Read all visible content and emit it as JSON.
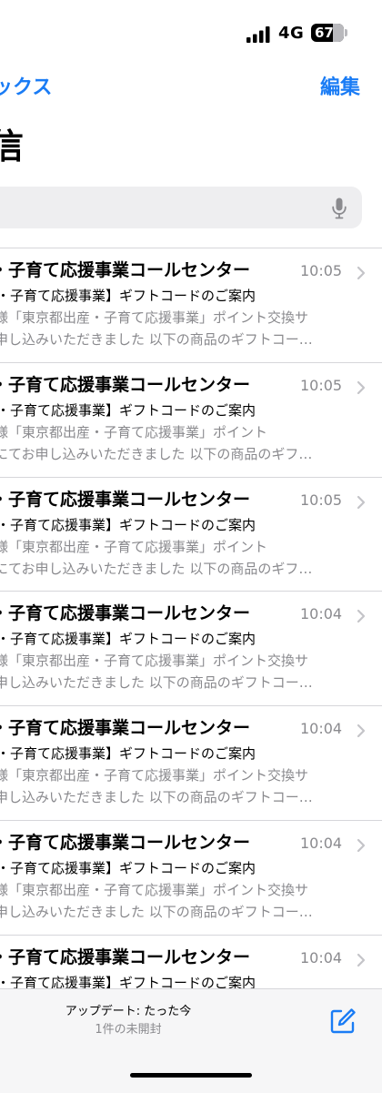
{
  "status_bar": {
    "network": "4G",
    "battery_level": "67",
    "battery_fraction": 0.67
  },
  "nav": {
    "back_label": "ックス",
    "edit_label": "編集",
    "title": "信"
  },
  "search": {
    "value": "",
    "mic_icon": "mic-icon"
  },
  "mails": [
    {
      "sender": "・子育て応援事業コールセンター",
      "time": "10:05",
      "subject": "・子育て応援事業】ギフトコードのご案内",
      "preview_line1": "様「東京都出産・子育て応援事業」ポイント交換サ",
      "preview_line2": "申し込みいただきました 以下の商品のギフトコー…"
    },
    {
      "sender": "・子育て応援事業コールセンター",
      "time": "10:05",
      "subject": "・子育て応援事業】ギフトコードのご案内",
      "preview_line1": "様「東京都出産・子育て応援事業」ポイント",
      "preview_line2": "にてお申し込みいただきました 以下の商品のギフ…"
    },
    {
      "sender": "・子育て応援事業コールセンター",
      "time": "10:05",
      "subject": "・子育て応援事業】ギフトコードのご案内",
      "preview_line1": "様「東京都出産・子育て応援事業」ポイント",
      "preview_line2": "にてお申し込みいただきました 以下の商品のギフ…"
    },
    {
      "sender": "・子育て応援事業コールセンター",
      "time": "10:04",
      "subject": "・子育て応援事業】ギフトコードのご案内",
      "preview_line1": "様「東京都出産・子育て応援事業」ポイント交換サ",
      "preview_line2": "申し込みいただきました 以下の商品のギフトコー…"
    },
    {
      "sender": "・子育て応援事業コールセンター",
      "time": "10:04",
      "subject": "・子育て応援事業】ギフトコードのご案内",
      "preview_line1": "様「東京都出産・子育て応援事業」ポイント交換サ",
      "preview_line2": "申し込みいただきました 以下の商品のギフトコー…"
    },
    {
      "sender": "・子育て応援事業コールセンター",
      "time": "10:04",
      "subject": "・子育て応援事業】ギフトコードのご案内",
      "preview_line1": "様「東京都出産・子育て応援事業」ポイント交換サ",
      "preview_line2": "申し込みいただきました 以下の商品のギフトコー…"
    },
    {
      "sender": "・子育て応援事業コールセンター",
      "time": "10:04",
      "subject": "・子育て応援事業】ギフトコードのご案内",
      "preview_line1": "",
      "preview_line2": ""
    }
  ],
  "toolbar": {
    "update_status": "アップデート: たった今",
    "unread_count": "1件の未開封",
    "compose_icon": "compose-icon"
  },
  "colors": {
    "accent": "#1a7cf5",
    "secondary_text": "#8a8a8e",
    "separator": "#d6d6da",
    "search_bg": "#eeeef0"
  }
}
